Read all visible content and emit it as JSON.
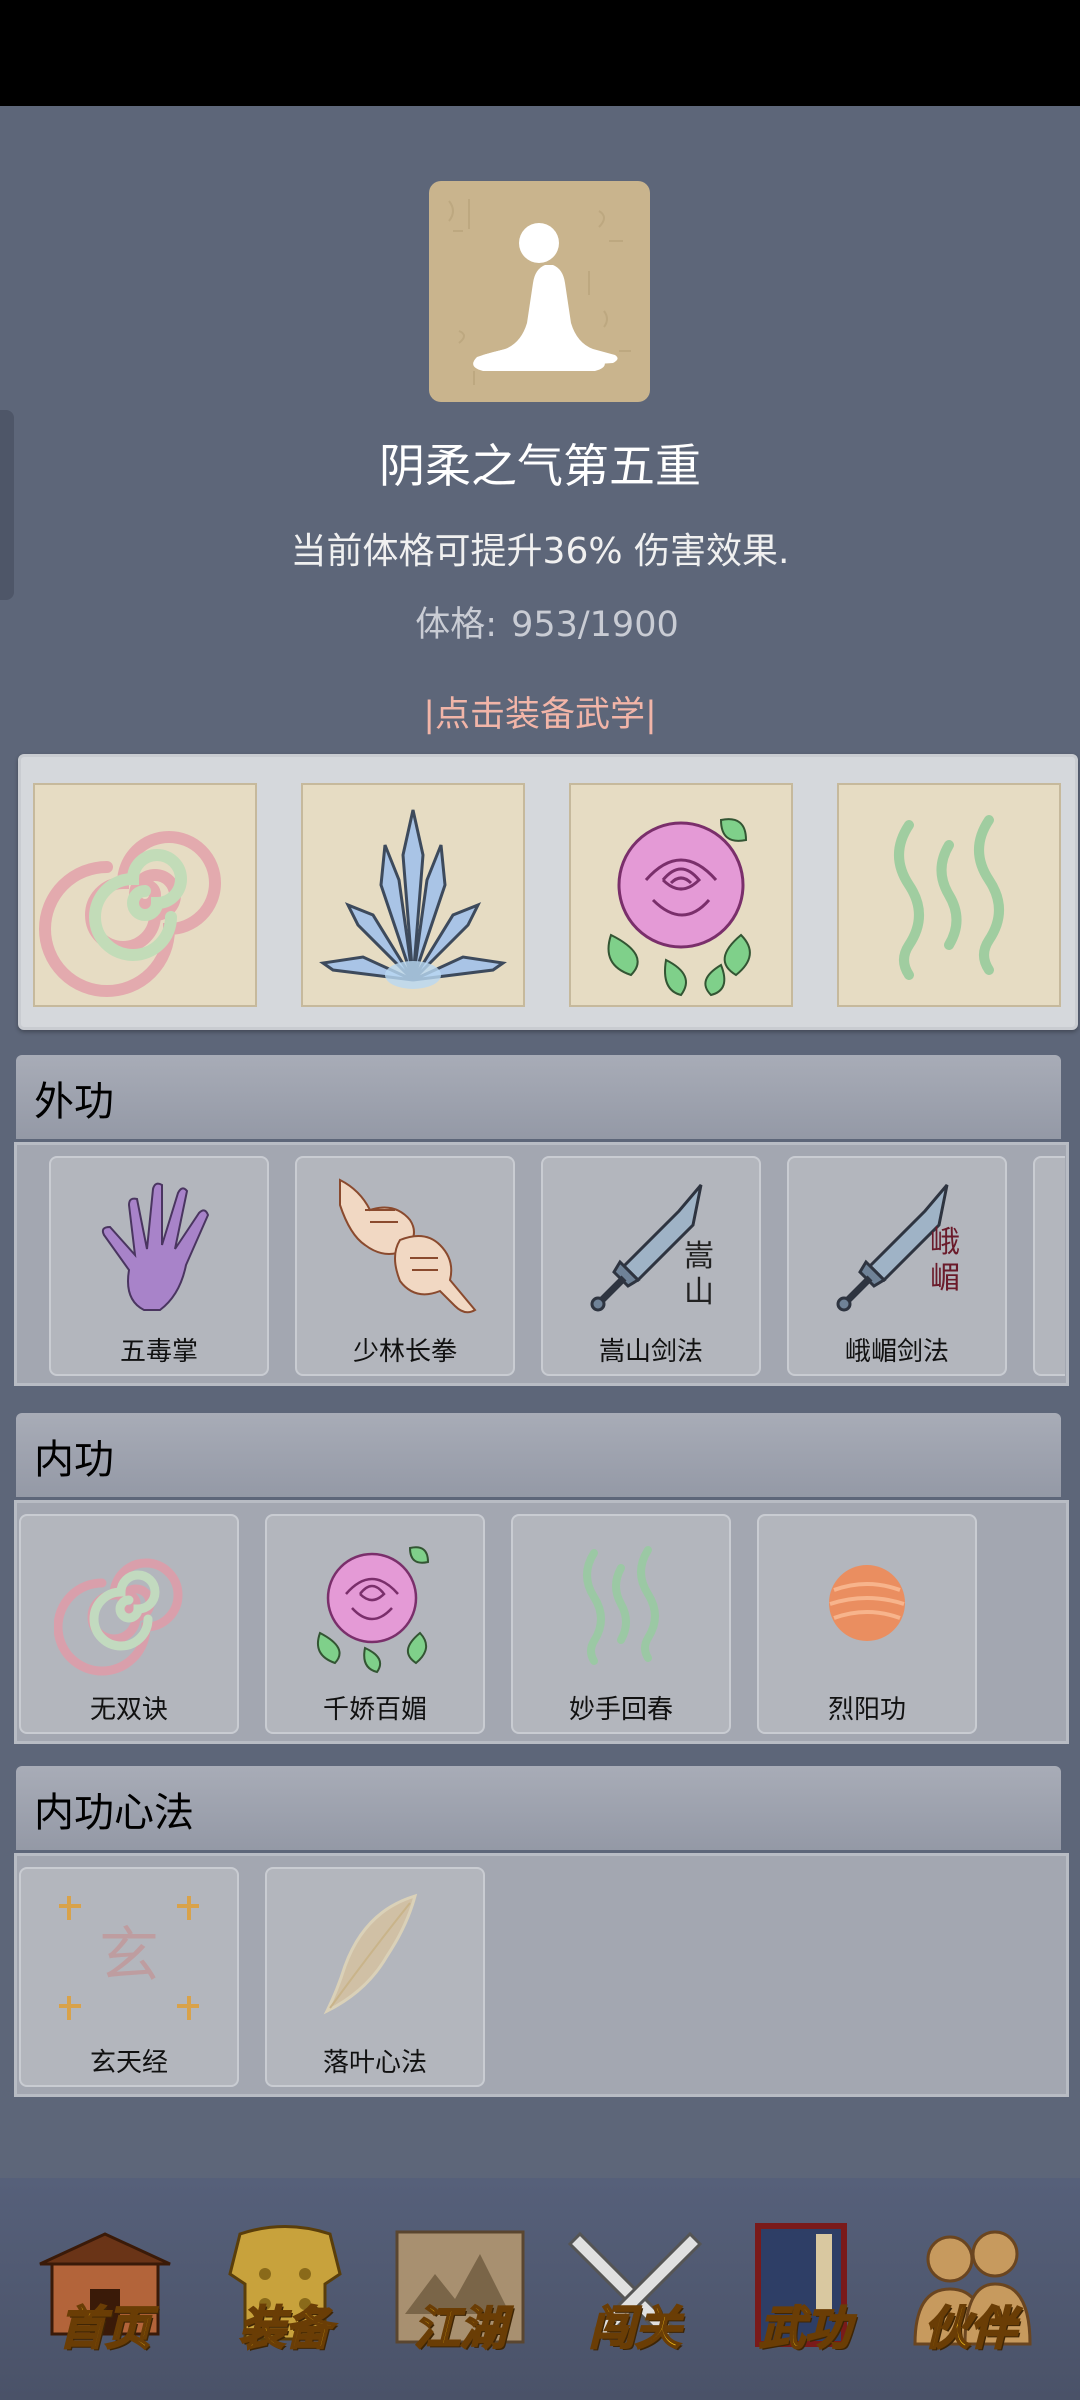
{
  "header": {
    "title": "阴柔之气第五重",
    "description": "当前体格可提升36% 伤害效果.",
    "stat_label": "体格:",
    "stat_value": "953/1900",
    "equip_hint": "|点击装备武学|"
  },
  "equipped": [
    {
      "icon": "spiral-icon"
    },
    {
      "icon": "crystal-shards-icon"
    },
    {
      "icon": "rose-icon"
    },
    {
      "icon": "green-waves-icon"
    }
  ],
  "sections": [
    {
      "title": "外功",
      "items": [
        {
          "label": "五毒掌",
          "icon": "purple-palm-icon"
        },
        {
          "label": "少林长拳",
          "icon": "fists-icon"
        },
        {
          "label": "嵩山剑法",
          "icon": "sword-icon",
          "glyph": "嵩山"
        },
        {
          "label": "峨嵋剑法",
          "icon": "sword-icon",
          "glyph": "峨嵋"
        }
      ]
    },
    {
      "title": "内功",
      "items": [
        {
          "label": "无双诀",
          "icon": "spiral-icon"
        },
        {
          "label": "千娇百媚",
          "icon": "rose-icon"
        },
        {
          "label": "妙手回春",
          "icon": "green-waves-icon"
        },
        {
          "label": "烈阳功",
          "icon": "sun-orb-icon"
        }
      ]
    },
    {
      "title": "内功心法",
      "items": [
        {
          "label": "玄天经",
          "icon": "xuan-seal-icon",
          "glyph": "玄"
        },
        {
          "label": "落叶心法",
          "icon": "leaf-icon"
        }
      ]
    }
  ],
  "nav": [
    {
      "label": "首页",
      "icon": "house-icon",
      "color": "#8a4a26"
    },
    {
      "label": "装备",
      "icon": "armor-icon",
      "color": "#c69a2a"
    },
    {
      "label": "江湖",
      "icon": "map-icon",
      "color": "#a08a65"
    },
    {
      "label": "闯关",
      "icon": "crossed-swords-icon",
      "color": "#d6d6d6"
    },
    {
      "label": "武功",
      "icon": "book-icon",
      "color": "#2e3e66"
    },
    {
      "label": "伙伴",
      "icon": "companions-icon",
      "color": "#c79a5e"
    }
  ]
}
